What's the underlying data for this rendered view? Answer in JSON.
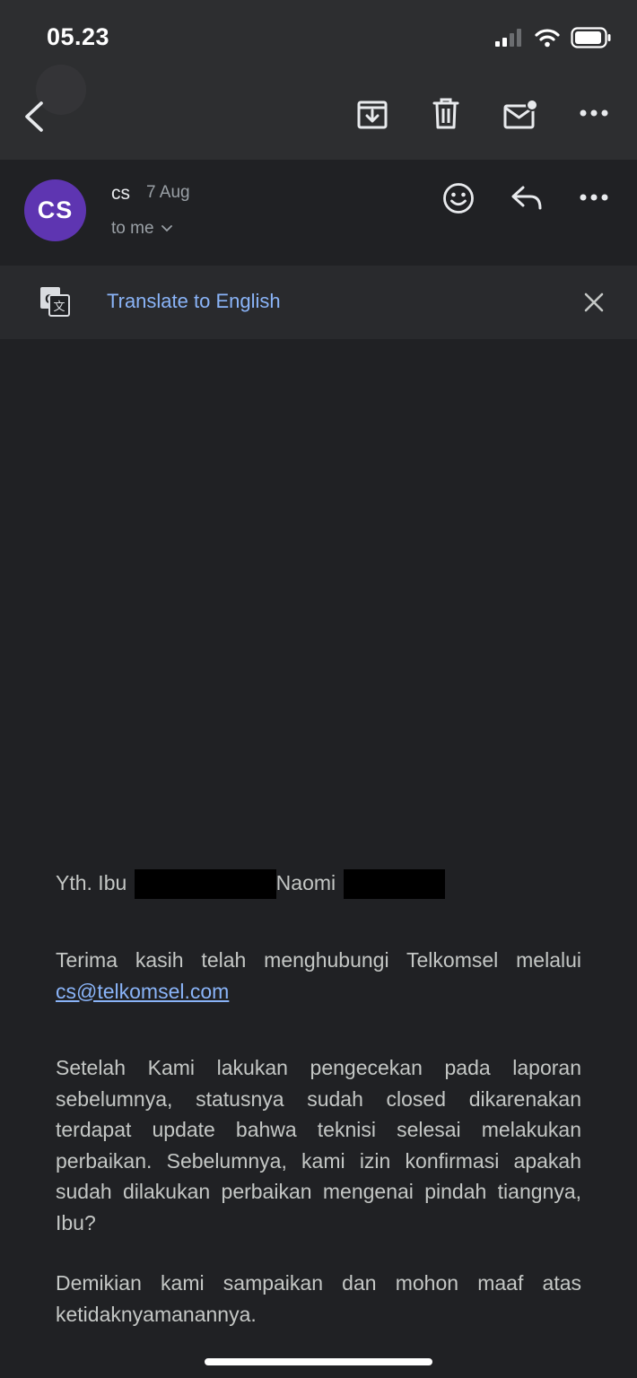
{
  "status_bar": {
    "time": "05.23"
  },
  "toolbar": {
    "back": "back-arrow-icon",
    "archive": "archive-icon",
    "delete": "trash-icon",
    "mark_unread": "mail-unread-icon",
    "more": "more-horizontal-icon"
  },
  "message_header": {
    "avatar_initials": "CS",
    "sender": "cs",
    "date": "7 Aug",
    "recipient": "to me"
  },
  "translate_bar": {
    "label": "Translate to English"
  },
  "email_body": {
    "greeting_prefix": "Yth. Ibu",
    "greeting_name": "Naomi",
    "para1_text": "Terima kasih telah menghubungi Telkomsel melalui",
    "para1_link": "cs@telkomsel.com",
    "para2": "Setelah Kami lakukan pengecekan pada laporan sebelumnya, statusnya sudah closed dikarenakan terdapat update bahwa teknisi selesai melakukan perbaikan. Sebelumnya, kami izin konfirmasi apakah sudah dilakukan perbaikan mengenai pindah tiangnya, Ibu?",
    "para3": "Demikian kami sampaikan dan mohon maaf atas ketidaknyamanannya."
  },
  "colors": {
    "background": "#202124",
    "toolbar": "#2d2e30",
    "avatar": "#5e35b1",
    "link": "#8ab4f8"
  }
}
